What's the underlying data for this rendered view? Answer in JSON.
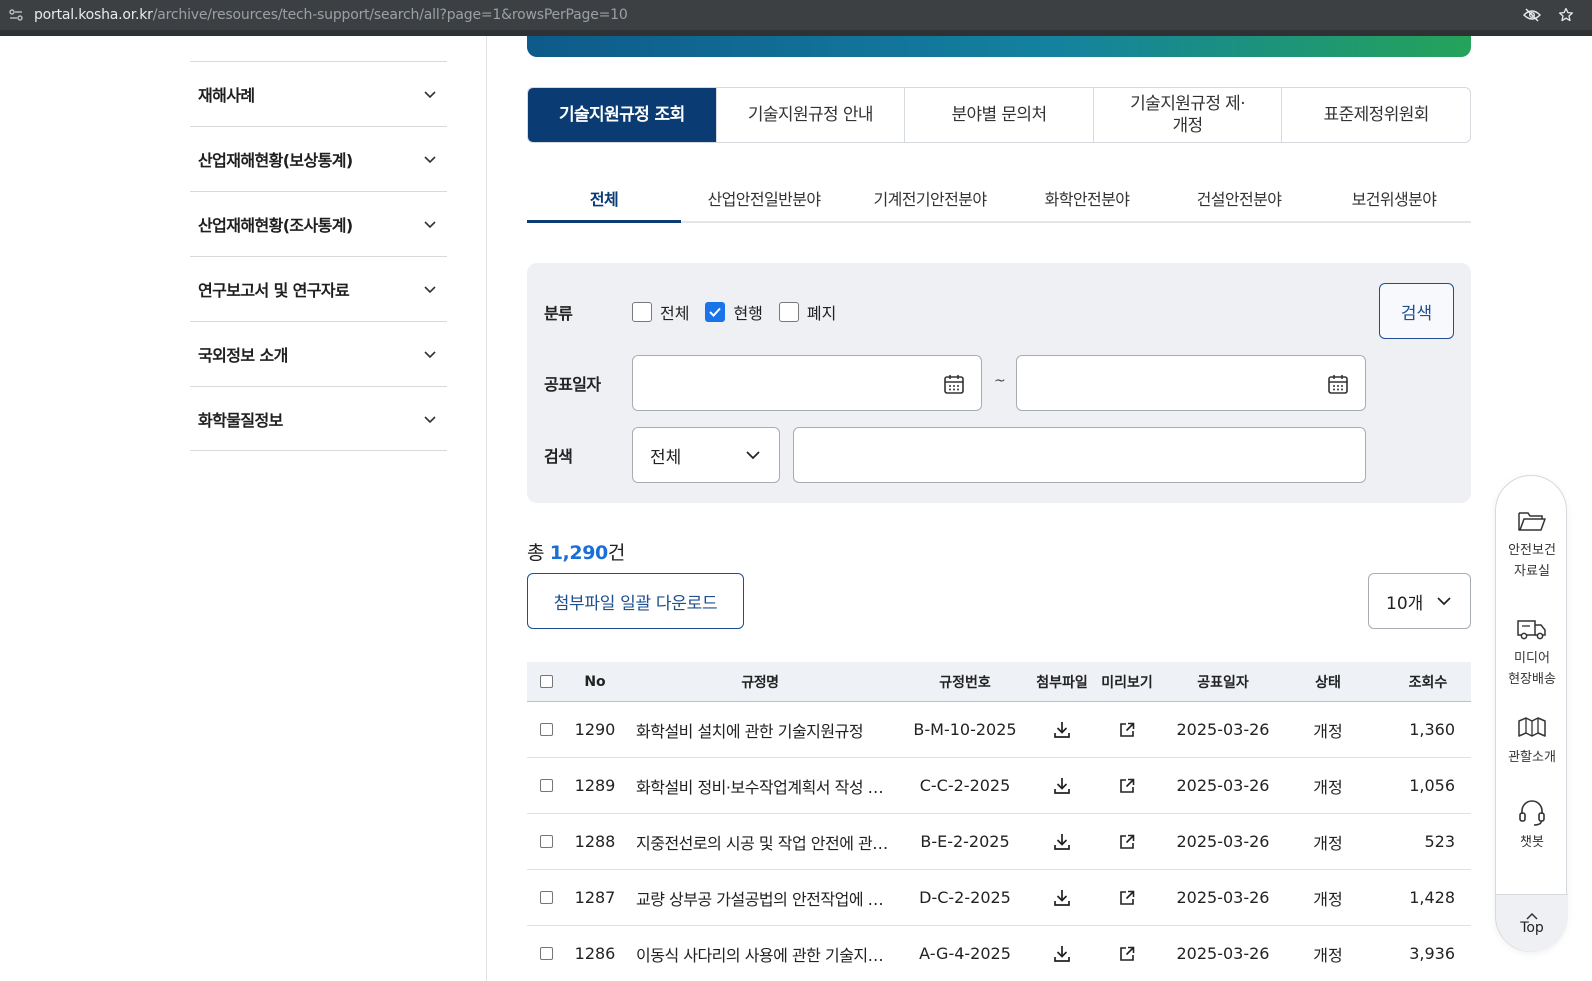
{
  "browser": {
    "url_host": "portal.kosha.or.kr",
    "url_path": "/archive/resources/tech-support/search/all?page=1&rowsPerPage=10"
  },
  "sidebar": {
    "items": [
      {
        "label": "재해사례"
      },
      {
        "label": "산업재해현황(보상통계)"
      },
      {
        "label": "산업재해현황(조사통계)"
      },
      {
        "label": "연구보고서 및 연구자료"
      },
      {
        "label": "국외정보 소개"
      },
      {
        "label": "화학물질정보"
      }
    ]
  },
  "main_tabs": [
    {
      "label": "기술지원규정 조회",
      "active": true
    },
    {
      "label": "기술지원규정 안내"
    },
    {
      "label": "분야별 문의처"
    },
    {
      "label": "기술지원규정 제·\n개정"
    },
    {
      "label": "표준제정위원회"
    }
  ],
  "sub_tabs": [
    {
      "label": "전체",
      "active": true
    },
    {
      "label": "산업안전일반분야"
    },
    {
      "label": "기계전기안전분야"
    },
    {
      "label": "화학안전분야"
    },
    {
      "label": "건설안전분야"
    },
    {
      "label": "보건위생분야"
    }
  ],
  "search": {
    "category_label": "분류",
    "checkboxes": [
      {
        "label": "전체",
        "checked": false
      },
      {
        "label": "현행",
        "checked": true
      },
      {
        "label": "폐지",
        "checked": false
      }
    ],
    "search_button": "검색",
    "date_label": "공표일자",
    "date_from": "",
    "date_to": "",
    "date_separator": "~",
    "keyword_label": "검색",
    "field_select": "전체",
    "keyword": ""
  },
  "results": {
    "total_prefix": "총 ",
    "total_count": "1,290",
    "total_suffix": "건",
    "bulk_download": "첨부파일 일괄 다운로드",
    "rows_per_page": "10개"
  },
  "table": {
    "headers": {
      "no": "No",
      "title": "규정명",
      "code": "규정번호",
      "file": "첨부파일",
      "preview": "미리보기",
      "date": "공표일자",
      "status": "상태",
      "views": "조회수"
    },
    "rows": [
      {
        "no": "1290",
        "title": "화학설비 설치에 관한 기술지원규정",
        "code": "B-M-10-2025",
        "date": "2025-03-26",
        "status": "개정",
        "views": "1,360"
      },
      {
        "no": "1289",
        "title": "화학설비 정비·보수작업계획서 작성 …",
        "code": "C-C-2-2025",
        "date": "2025-03-26",
        "status": "개정",
        "views": "1,056"
      },
      {
        "no": "1288",
        "title": "지중전선로의 시공 및 작업 안전에 관…",
        "code": "B-E-2-2025",
        "date": "2025-03-26",
        "status": "개정",
        "views": "523"
      },
      {
        "no": "1287",
        "title": "교량 상부공 가설공법의 안전작업에 …",
        "code": "D-C-2-2025",
        "date": "2025-03-26",
        "status": "개정",
        "views": "1,428"
      },
      {
        "no": "1286",
        "title": "이동식 사다리의 사용에 관한 기술지…",
        "code": "A-G-4-2025",
        "date": "2025-03-26",
        "status": "개정",
        "views": "3,936"
      }
    ]
  },
  "quick_menu": {
    "items": [
      {
        "label": "안전보건\n자료실",
        "icon": "folder-icon"
      },
      {
        "label": "미디어\n현장배송",
        "icon": "delivery-truck-icon"
      },
      {
        "label": "관할소개",
        "icon": "map-icon"
      },
      {
        "label": "챗봇",
        "icon": "headset-icon"
      }
    ],
    "top_label": "Top"
  },
  "colors": {
    "primary_navy": "#0b3b73",
    "accent_blue": "#1a6fd6",
    "checkbox_blue": "#1a73e8",
    "panel_bg": "#eef0f3"
  }
}
